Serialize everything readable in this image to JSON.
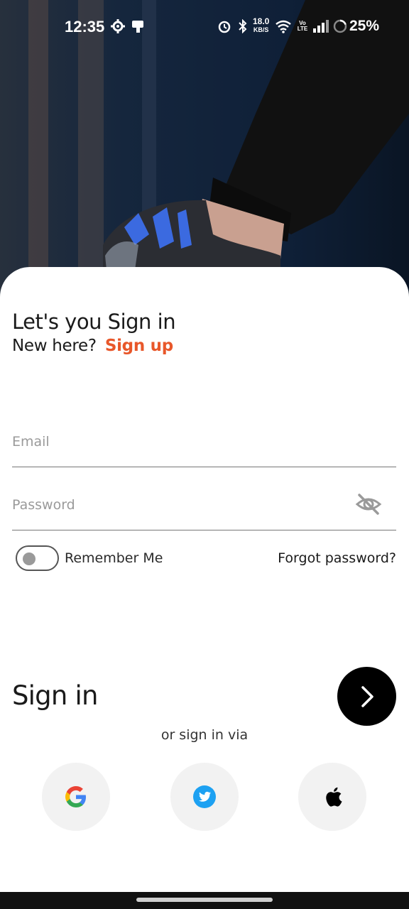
{
  "status_bar": {
    "time": "12:35",
    "net_speed_value": "18.0",
    "net_speed_unit": "KB/S",
    "battery": "25%",
    "icons": [
      "settings-icon",
      "notification-icon",
      "alarm-icon",
      "bluetooth-icon",
      "wifi-icon",
      "volte-icon",
      "signal-icon",
      "battery-icon"
    ]
  },
  "hero": {
    "description_icon": "shoe-photo"
  },
  "form": {
    "heading": "Let's you Sign in",
    "new_here": "New here?",
    "signup_label": "Sign up",
    "email_placeholder": "Email",
    "password_placeholder": "Password",
    "remember_label": "Remember Me",
    "forgot_label": "Forgot password?",
    "signin_title": "Sign in",
    "or_text": "or sign in via"
  },
  "social": {
    "providers": [
      "google-icon",
      "twitter-icon",
      "apple-icon"
    ]
  },
  "colors": {
    "accent": "#e8572a",
    "primary_button": "#000000",
    "social_bg": "#f2f2f2",
    "twitter_blue": "#1da1f2"
  }
}
